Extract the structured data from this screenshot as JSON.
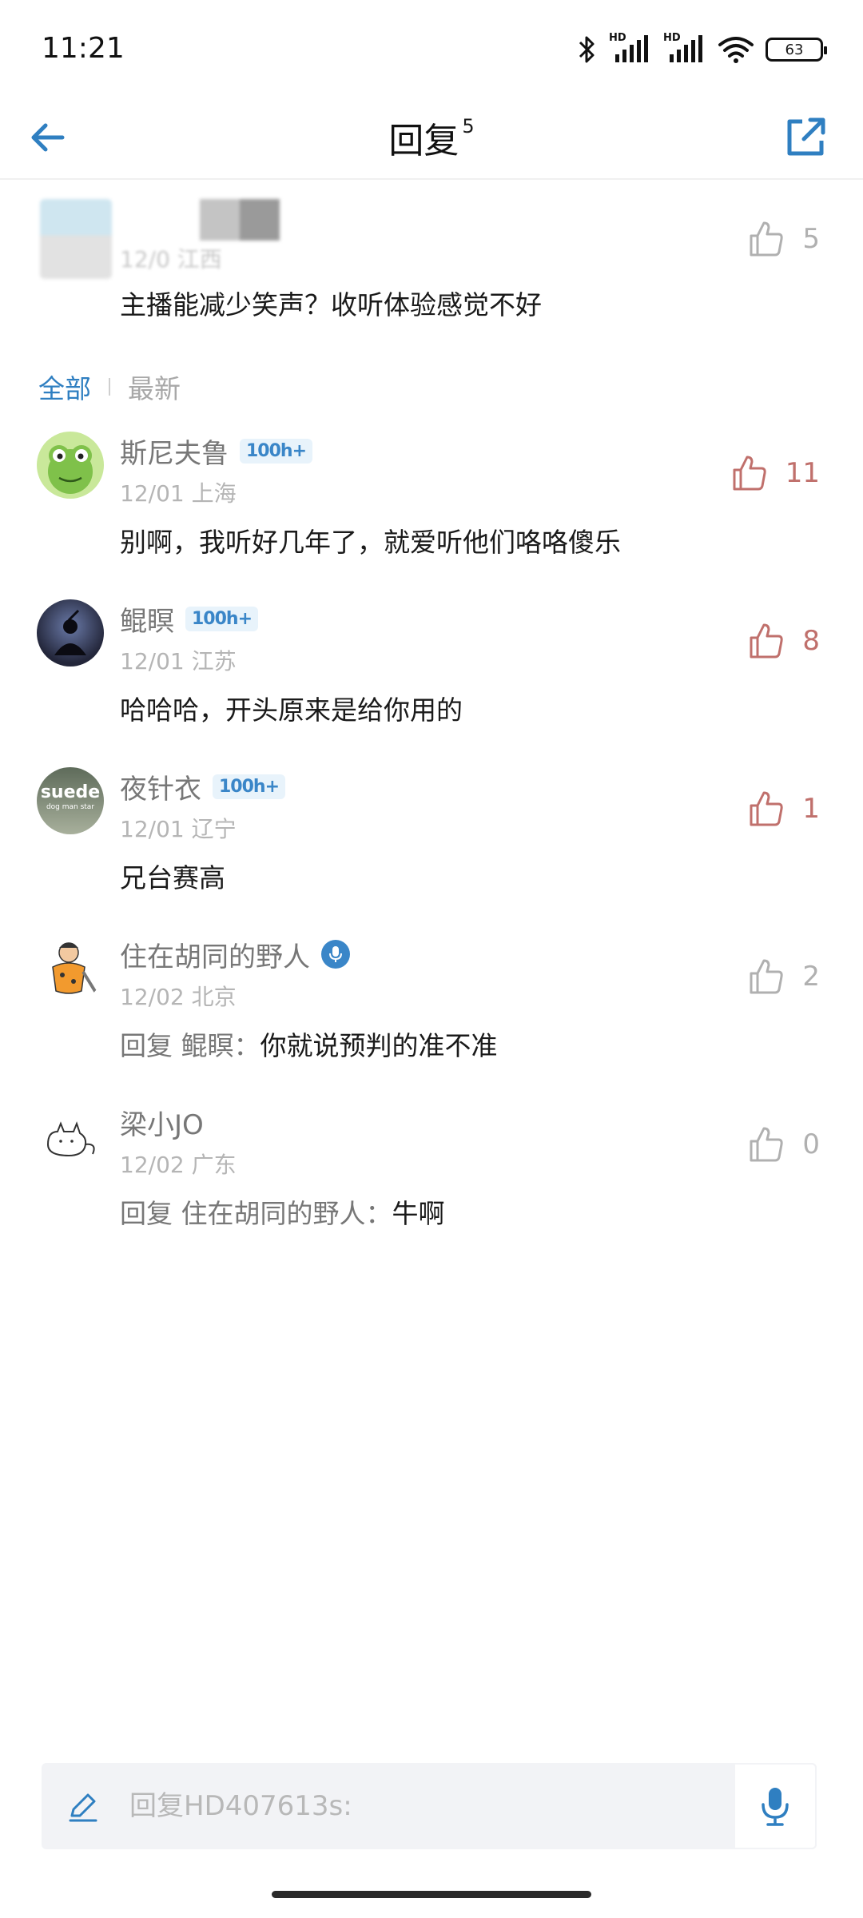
{
  "status_bar": {
    "time": "11:21",
    "network_label_1": "HD",
    "network_label_2": "HD",
    "battery": "63",
    "icons": [
      "bluetooth-icon",
      "signal-icon",
      "signal-icon",
      "wifi-icon",
      "battery-icon"
    ]
  },
  "header": {
    "title": "回复",
    "count": "5",
    "back_icon": "arrow-left-icon",
    "share_icon": "share-external-icon"
  },
  "original_comment": {
    "meta_partial": "12/0 江西",
    "text": "主播能减少笑声？收听体验感觉不好",
    "likes": "5"
  },
  "tabs": [
    {
      "label": "全部",
      "active": true
    },
    {
      "label": "最新",
      "active": false
    }
  ],
  "replies": [
    {
      "name": "斯尼夫鲁",
      "level": "100h+",
      "meta": "12/01 上海",
      "text": "别啊，我听好几年了，就爱听他们咯咯傻乐",
      "likes": "11",
      "liked": true
    },
    {
      "name": "鲲瞑",
      "level": "100h+",
      "meta": "12/01 江苏",
      "text": "哈哈哈，开头原来是给你用的",
      "likes": "8",
      "liked": true
    },
    {
      "name": "夜针衣",
      "level": "100h+",
      "meta": "12/01 辽宁",
      "text": "兄台赛高",
      "likes": "1",
      "liked": true,
      "avatar_text_1": "suede",
      "avatar_text_2": "dog man star"
    },
    {
      "name": "住在胡同的野人",
      "meta": "12/02 北京",
      "reply_prefix": "回复 鲲瞑：",
      "text": "你就说预判的准不准",
      "likes": "2",
      "liked": false
    },
    {
      "name": "梁小JO",
      "meta": "12/02 广东",
      "reply_prefix": "回复 住在胡同的野人：",
      "text": "牛啊",
      "likes": "0",
      "liked": false
    }
  ],
  "input": {
    "placeholder": "回复HD407613s:",
    "pencil_icon": "pencil-icon",
    "mic_icon": "microphone-icon"
  },
  "colors": {
    "accent": "#2f7fc1",
    "liked": "#c0706c",
    "unliked": "#b0b0b0"
  }
}
